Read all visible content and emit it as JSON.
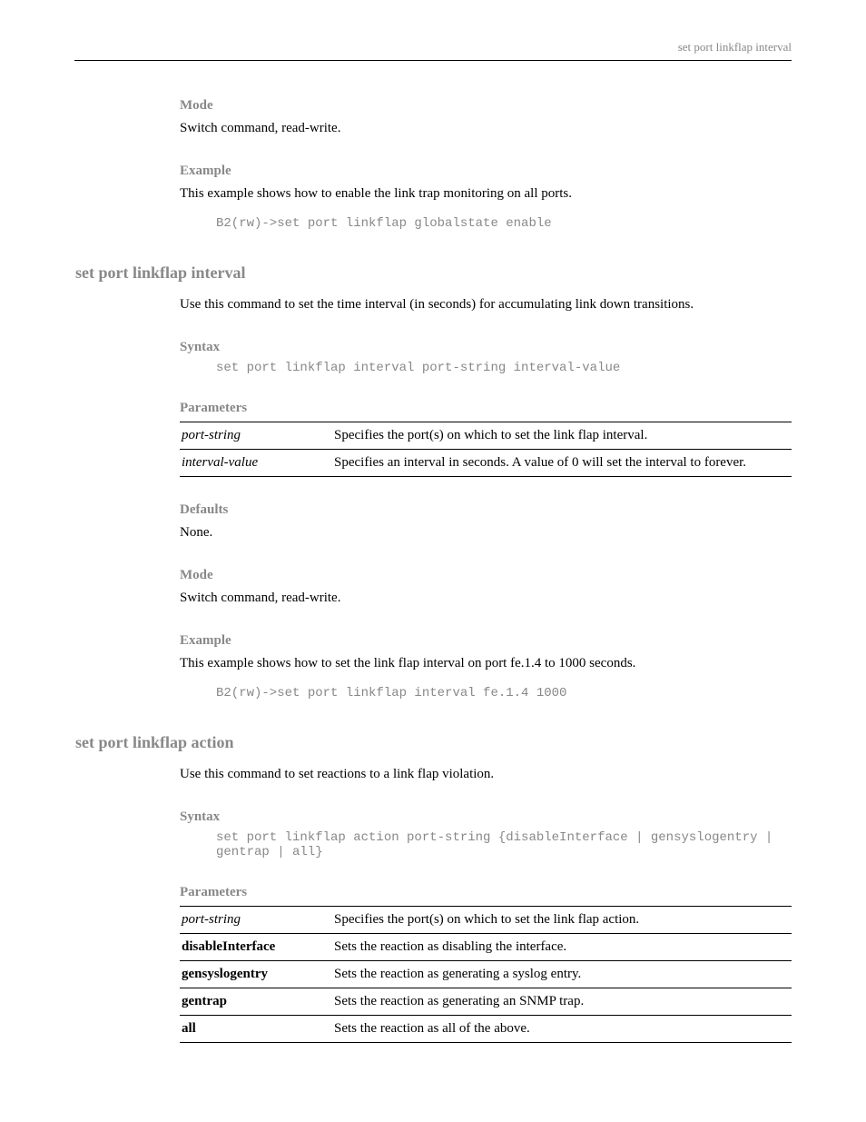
{
  "headerText": "set port linkflap interval",
  "sections": [
    {
      "heading": "Mode",
      "body": "Switch command, read-write.",
      "firstHeading": true
    },
    {
      "heading": "Example",
      "body": "This example shows how to enable the link trap monitoring on all ports.",
      "code": "B2(rw)->set port linkflap globalstate enable"
    }
  ],
  "command1": {
    "title": "set port linkflap interval",
    "description": "Use this command to set the time interval (in seconds) for accumulating link down transitions.",
    "syntaxHeading": "Syntax",
    "syntax": "set port linkflap interval port-string interval-value",
    "paramsHeading": "Parameters",
    "params": [
      {
        "name": "port-string",
        "italic": true,
        "desc": "Specifies the port(s) on which to set the link flap interval."
      },
      {
        "name": "interval-value",
        "italic": true,
        "desc": "Specifies an interval in seconds. A value of 0 will set the interval to forever."
      }
    ],
    "defaultsHeading": "Defaults",
    "defaults": "None.",
    "modeHeading": "Mode",
    "mode": "Switch command, read-write.",
    "exampleHeading": "Example",
    "exampleText": "This example shows how to set the link flap interval on port fe.1.4 to 1000 seconds.",
    "exampleCode": "B2(rw)->set port linkflap interval fe.1.4 1000"
  },
  "command2": {
    "title": "set port linkflap action",
    "description": "Use this command to set reactions to a link flap violation.",
    "syntaxHeading": "Syntax",
    "syntax": "set port linkflap action port-string {disableInterface | gensyslogentry | gentrap | all}",
    "paramsHeading": "Parameters",
    "params": [
      {
        "name": "port-string",
        "italic": true,
        "desc": "Specifies the port(s) on which to set the link flap action."
      },
      {
        "name": "disableInterface",
        "italic": false,
        "desc": "Sets the reaction as disabling the interface."
      },
      {
        "name": "gensyslogentry",
        "italic": false,
        "desc": "Sets the reaction as generating a syslog entry."
      },
      {
        "name": "gentrap",
        "italic": false,
        "desc": "Sets the reaction as generating an SNMP trap."
      },
      {
        "name": "all",
        "italic": false,
        "desc": "Sets the reaction as all of the above."
      }
    ]
  }
}
